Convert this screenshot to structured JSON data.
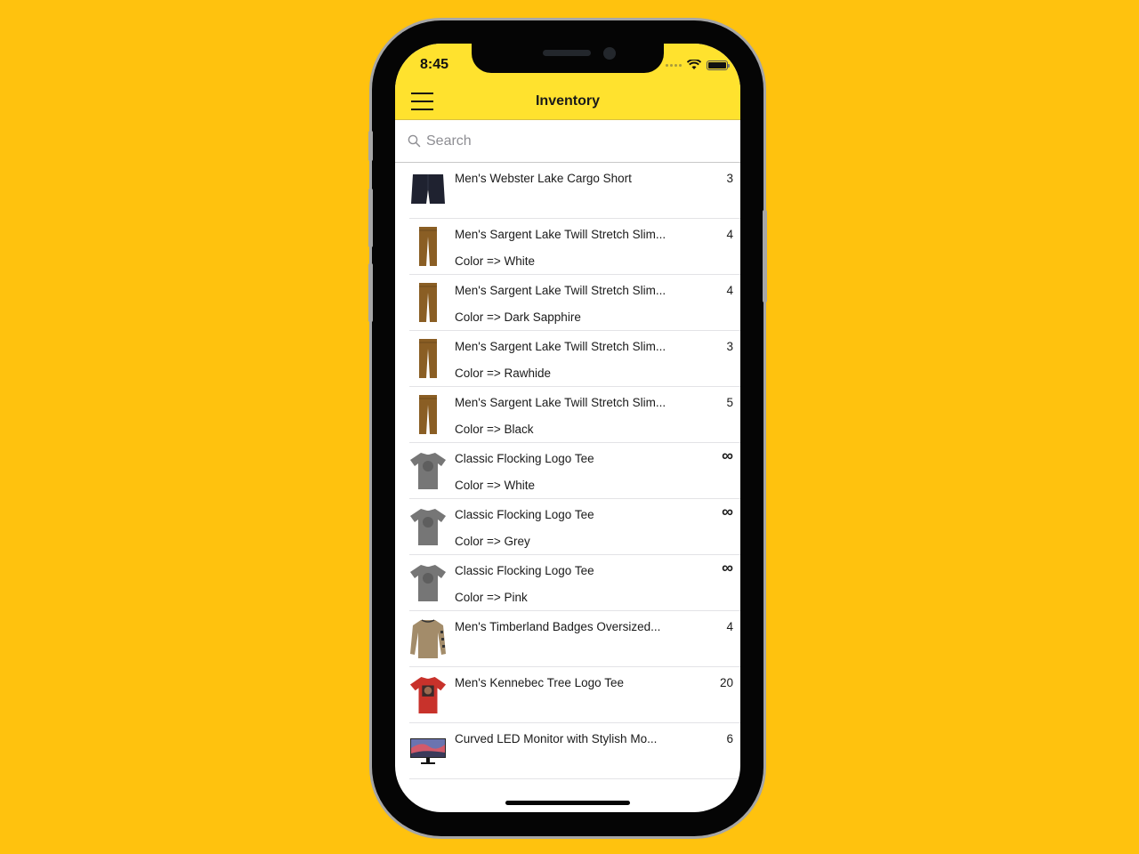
{
  "status_bar": {
    "time": "8:45"
  },
  "header": {
    "title": "Inventory",
    "menu_icon": "hamburger-menu-icon"
  },
  "search": {
    "placeholder": "Search",
    "value": ""
  },
  "colors": {
    "background": "#FFC20E",
    "header": "#FFE22E"
  },
  "items": [
    {
      "name": "Men's Webster Lake Cargo Short",
      "variant": "",
      "quantity": "3",
      "thumb": "cargo-short-navy-icon"
    },
    {
      "name": "Men's Sargent Lake Twill Stretch Slim...",
      "variant": "Color => White",
      "quantity": "4",
      "thumb": "pants-tan-icon"
    },
    {
      "name": "Men's Sargent Lake Twill Stretch Slim...",
      "variant": "Color => Dark Sapphire",
      "quantity": "4",
      "thumb": "pants-tan-icon"
    },
    {
      "name": "Men's Sargent Lake Twill Stretch Slim...",
      "variant": "Color => Rawhide",
      "quantity": "3",
      "thumb": "pants-tan-icon"
    },
    {
      "name": "Men's Sargent Lake Twill Stretch Slim...",
      "variant": "Color => Black",
      "quantity": "5",
      "thumb": "pants-tan-icon"
    },
    {
      "name": "Classic Flocking Logo Tee",
      "variant": "Color => White",
      "quantity": "∞",
      "thumb": "tee-grey-icon"
    },
    {
      "name": "Classic Flocking Logo Tee",
      "variant": "Color => Grey",
      "quantity": "∞",
      "thumb": "tee-grey-icon"
    },
    {
      "name": "Classic Flocking Logo Tee",
      "variant": "Color => Pink",
      "quantity": "∞",
      "thumb": "tee-grey-icon"
    },
    {
      "name": "Men's Timberland Badges Oversized...",
      "variant": "",
      "quantity": "4",
      "thumb": "longsleeve-tan-icon"
    },
    {
      "name": "Men's Kennebec Tree Logo Tee",
      "variant": "",
      "quantity": "20",
      "thumb": "tee-red-icon"
    },
    {
      "name": "Curved LED Monitor with Stylish Mo...",
      "variant": "",
      "quantity": "6",
      "thumb": "monitor-icon"
    }
  ]
}
